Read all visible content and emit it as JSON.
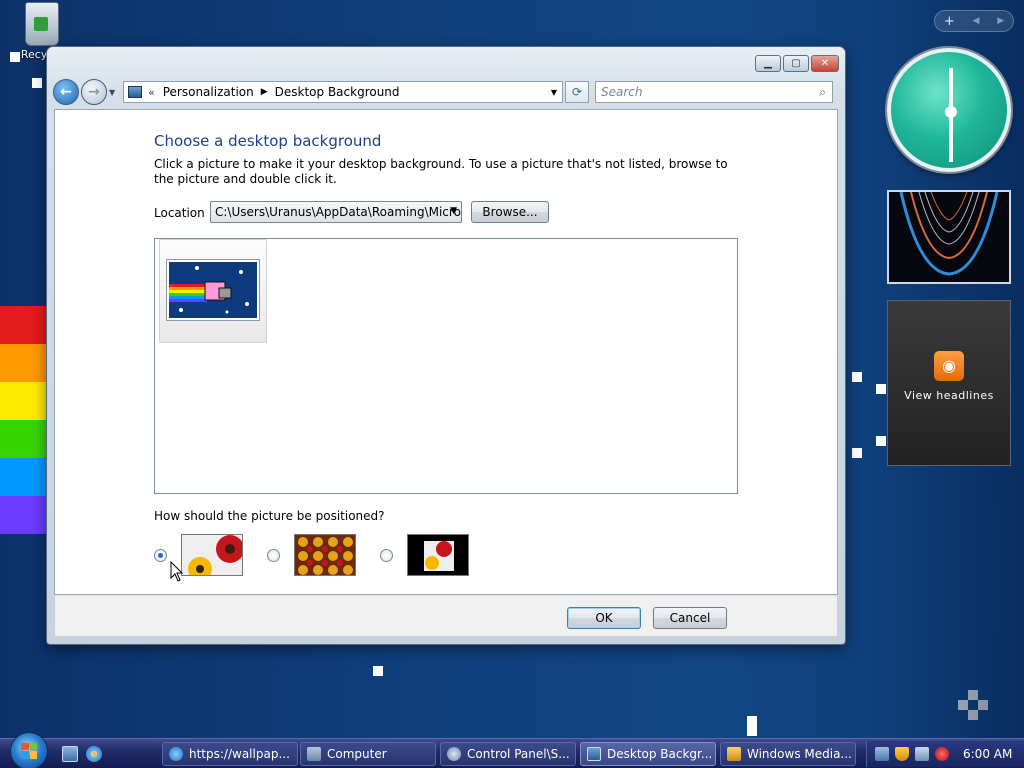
{
  "desktop": {
    "recycle_label": "Recycle"
  },
  "gadgets": {
    "sidebar_control": {
      "add": "+",
      "prev": "◀",
      "next": "▶"
    },
    "feeds_label": "View headlines"
  },
  "window": {
    "breadcrumb": [
      "Personalization",
      "Desktop Background"
    ],
    "search_placeholder": "Search",
    "heading": "Choose a desktop background",
    "description": "Click a picture to make it your desktop background. To use a picture that's not listed, browse to the picture and double click it.",
    "location_label": "Location",
    "location_value": "C:\\Users\\Uranus\\AppData\\Roaming\\Micro",
    "browse_label": "Browse...",
    "position_question": "How should the picture be positioned?",
    "position_options": [
      {
        "id": "fit-to-screen",
        "selected": true
      },
      {
        "id": "tile",
        "selected": false
      },
      {
        "id": "center",
        "selected": false
      }
    ],
    "ok_label": "OK",
    "cancel_label": "Cancel"
  },
  "taskbar": {
    "buttons": [
      {
        "label": "https://wallpap...",
        "icon": "ie-icon"
      },
      {
        "label": "Computer",
        "icon": "computer-icon"
      },
      {
        "label": "Control Panel\\S...",
        "icon": "control-panel-icon"
      },
      {
        "label": "Desktop Backgr...",
        "icon": "desktop-background-icon",
        "active": true
      },
      {
        "label": "Windows Media...",
        "icon": "media-player-icon"
      }
    ],
    "clock": "6:00 AM"
  },
  "colors": {
    "heading": "#1e3f8a",
    "taskbar": "#1f2b66",
    "clock_face": "#1fb79b"
  }
}
